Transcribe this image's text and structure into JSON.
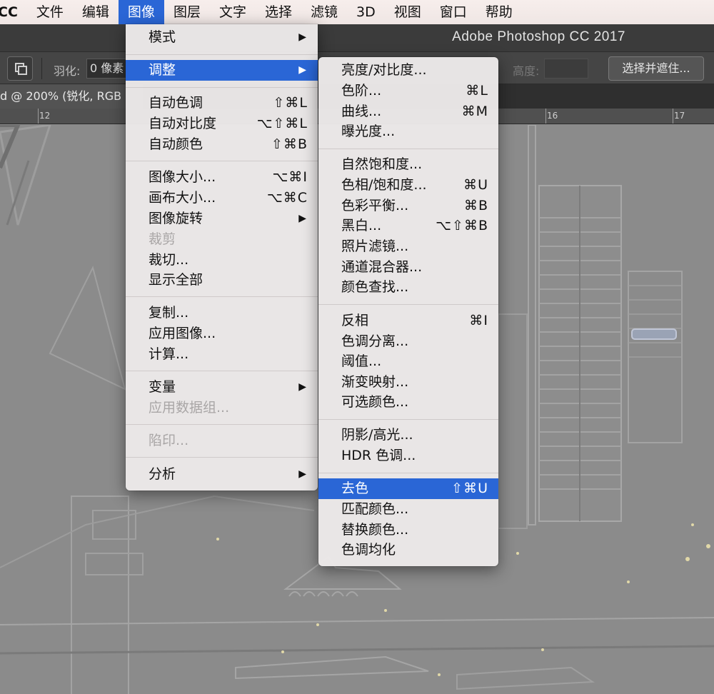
{
  "menubar": {
    "items": [
      "CC",
      "文件",
      "编辑",
      "图像",
      "图层",
      "文字",
      "选择",
      "滤镜",
      "3D",
      "视图",
      "窗口",
      "帮助"
    ],
    "active_index": 3
  },
  "titlebar": {
    "title": "Adobe Photoshop CC 2017"
  },
  "options_bar": {
    "feather_label": "羽化:",
    "feather_value": "0 像素",
    "height_label": "高度:",
    "select_mask_label": "选择并遮住..."
  },
  "document": {
    "tab_title": "d @ 200% (锐化, RGB"
  },
  "ruler": {
    "labels": [
      "12",
      "16",
      "17"
    ]
  },
  "image_menu": {
    "items": [
      {
        "label": "模式",
        "submenu": true
      },
      {
        "label": "调整",
        "submenu": true,
        "highlighted": true
      },
      {
        "label": "自动色调",
        "shortcut": "⇧⌘L"
      },
      {
        "label": "自动对比度",
        "shortcut": "⌥⇧⌘L"
      },
      {
        "label": "自动颜色",
        "shortcut": "⇧⌘B"
      },
      {
        "label": "图像大小...",
        "shortcut": "⌥⌘I"
      },
      {
        "label": "画布大小...",
        "shortcut": "⌥⌘C"
      },
      {
        "label": "图像旋转",
        "submenu": true
      },
      {
        "label": "裁剪",
        "disabled": true
      },
      {
        "label": "裁切..."
      },
      {
        "label": "显示全部"
      },
      {
        "label": "复制..."
      },
      {
        "label": "应用图像..."
      },
      {
        "label": "计算..."
      },
      {
        "label": "变量",
        "submenu": true
      },
      {
        "label": "应用数据组...",
        "disabled": true
      },
      {
        "label": "陷印...",
        "disabled": true
      },
      {
        "label": "分析",
        "submenu": true
      }
    ]
  },
  "adjust_menu": {
    "items": [
      {
        "label": "亮度/对比度..."
      },
      {
        "label": "色阶...",
        "shortcut": "⌘L"
      },
      {
        "label": "曲线...",
        "shortcut": "⌘M"
      },
      {
        "label": "曝光度..."
      },
      {
        "label": "自然饱和度..."
      },
      {
        "label": "色相/饱和度...",
        "shortcut": "⌘U"
      },
      {
        "label": "色彩平衡...",
        "shortcut": "⌘B"
      },
      {
        "label": "黑白...",
        "shortcut": "⌥⇧⌘B"
      },
      {
        "label": "照片滤镜..."
      },
      {
        "label": "通道混合器..."
      },
      {
        "label": "颜色查找..."
      },
      {
        "label": "反相",
        "shortcut": "⌘I"
      },
      {
        "label": "色调分离..."
      },
      {
        "label": "阈值..."
      },
      {
        "label": "渐变映射..."
      },
      {
        "label": "可选颜色..."
      },
      {
        "label": "阴影/高光..."
      },
      {
        "label": "HDR 色调..."
      },
      {
        "label": "去色",
        "shortcut": "⇧⌘U",
        "highlighted": true
      },
      {
        "label": "匹配颜色..."
      },
      {
        "label": "替换颜色..."
      },
      {
        "label": "色调均化"
      }
    ]
  },
  "icons": {
    "submenu_arrow": "▶",
    "tool_icon": "selection-mode-icon"
  },
  "colors": {
    "highlight": "#2a66d6",
    "menu_bg": "#ece9e9",
    "canvas": "#888888"
  }
}
